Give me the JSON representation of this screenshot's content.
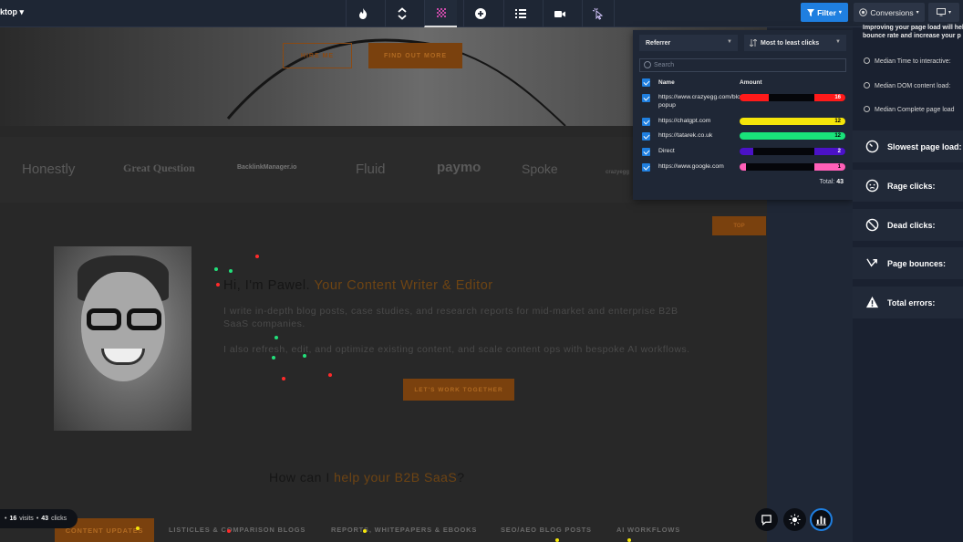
{
  "toolbar": {
    "device_label": "ktop",
    "filter_label": "Filter",
    "conversions_label": "Conversions"
  },
  "page": {
    "hero_hire": "HIRE ME",
    "hero_more": "FIND OUT MORE",
    "logos": [
      "Honestly",
      "Great Question",
      "BacklinkManager.io",
      "Fluid",
      "paymo",
      "Spoke",
      "crazyegg"
    ],
    "top_button": "TOP",
    "greeting": "Hi, I'm Pawel. ",
    "greeting_accent": "Your Content Writer & Editor",
    "para1": "I write in-depth blog posts, case studies, and research reports for mid-market and enterprise B2B SaaS companies.",
    "para2": "I also refresh, edit, and optimize existing content, and scale content ops with bespoke AI workflows.",
    "cta": "LET'S WORK TOGETHER",
    "how": "How can I ",
    "how_accent": "help your B2B SaaS",
    "how_end": "?",
    "tabs": [
      "CONTENT UPDATES",
      "LISTICLES & COMPARISON BLOGS",
      "REPORTS, WHITEPAPERS & EBOOKS",
      "SEO/AEO BLOG POSTS",
      "AI WORKFLOWS"
    ]
  },
  "panel": {
    "dim_select": "Referrer",
    "sort_select": "Most to least clicks",
    "search_placeholder": "Search",
    "col_name": "Name",
    "col_amount": "Amount",
    "rows": [
      {
        "name": "https://www.crazyegg.com/blog/exit-popup",
        "count": "16",
        "value": 16,
        "color": "#ff1a1a",
        "text": "#ffffff"
      },
      {
        "name": "https://chatgpt.com",
        "count": "12",
        "value": 12,
        "color": "#f5e50a",
        "text": "#000000"
      },
      {
        "name": "https://tatarek.co.uk",
        "count": "12",
        "value": 12,
        "color": "#19e27a",
        "text": "#000000"
      },
      {
        "name": "Direct",
        "count": "2",
        "value": 2,
        "color": "#4b12c7",
        "text": "#ffffff"
      },
      {
        "name": "https://www.google.com",
        "count": "1",
        "value": 1,
        "color": "#ff5fb8",
        "text": "#000000"
      }
    ],
    "total_label": "Total:",
    "total_value": "43"
  },
  "insights": {
    "top_text": "Improving your page load will help bounce rate and increase your p",
    "metrics": [
      "Median Time to interactive:",
      "Median DOM content load:",
      "Median Complete page load"
    ],
    "cards": [
      "Slowest page load:",
      "Rage clicks:",
      "Dead clicks:",
      "Page bounces:",
      "Total errors:"
    ]
  },
  "footer": {
    "visits_count": "16",
    "visits_label": "visits",
    "clicks_count": "43",
    "clicks_label": "clicks"
  }
}
